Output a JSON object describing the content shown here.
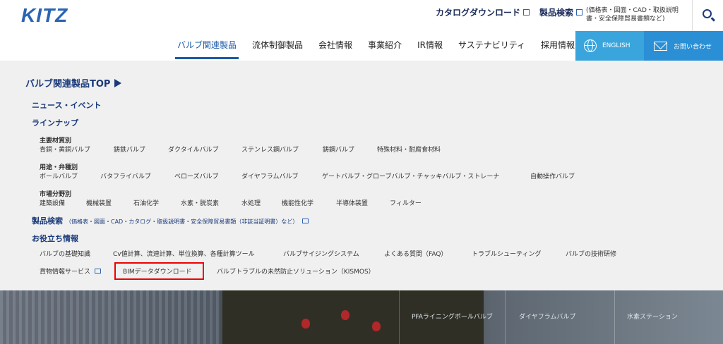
{
  "header": {
    "logo": "KITZ",
    "catalog_download": "カタログダウンロード",
    "product_search": "製品検索",
    "product_search_note": "(価格表・図面・CAD・取扱説明書・安全保障貿易書類など)"
  },
  "nav": {
    "items": [
      "バルブ関連製品",
      "流体制御製品",
      "会社情報",
      "事業紹介",
      "IR情報",
      "サステナビリティ",
      "採用情報"
    ],
    "english": "ENGLISH",
    "contact": "お問い合わせ"
  },
  "mega": {
    "top_link": "バルブ関連製品TOP",
    "news": "ニュース・イベント",
    "lineup": "ラインナップ",
    "material_heading": "主要材質別",
    "materials": [
      "青銅・黄銅バルブ",
      "鋳鉄バルブ",
      "ダクタイルバルブ",
      "ステンレス鋼バルブ",
      "鋳鋼バルブ",
      "特殊材料・耐腐食材料"
    ],
    "usage_heading": "用途・弁種別",
    "usages": [
      "ボールバルブ",
      "バタフライバルブ",
      "ベローズバルブ",
      "ダイヤフラムバルブ",
      "ゲートバルブ・グローブバルブ・チャッキバルブ・ストレーナ",
      "自動操作バルブ"
    ],
    "market_heading": "市場分野別",
    "markets": [
      "建築設備",
      "機械装置",
      "石油化学",
      "水素・脱炭素",
      "水処理",
      "機能性化学",
      "半導体装置",
      "フィルター"
    ],
    "product_search": "製品検索",
    "product_search_note": "（価格表・図面・CAD・カタログ・取扱説明書・安全保障貿易書類（非該当証明書）など）",
    "useful_heading": "お役立ち情報",
    "useful_row1": [
      "バルブの基礎知識",
      "Cv値計算、流速計算、単位換算、各種計算ツール",
      "バルブサイジングシステム",
      "よくある質問（FAQ）",
      "トラブルシューティング",
      "バルブの技術研修"
    ],
    "useful_row2": [
      "貨物情報サービス",
      "BIMデータダウンロード",
      "バルブトラブルの未然防止ソリューション（KISMOS）"
    ]
  },
  "banner": {
    "labels": [
      "PFAライニングボールバルブ",
      "ダイヤフラムバルブ",
      "水素ステーション"
    ]
  }
}
